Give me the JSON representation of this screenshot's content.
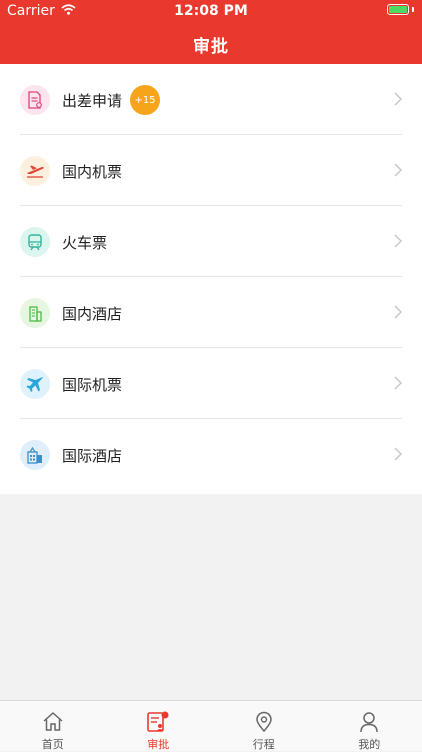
{
  "status_bar": {
    "carrier": "Carrier",
    "time": "12:08 PM"
  },
  "header": {
    "title": "审批"
  },
  "colors": {
    "accent": "#e9392f",
    "badge": "#f6a51b"
  },
  "menu": {
    "items": [
      {
        "label": "出差申请",
        "icon": "document-form-icon",
        "badge": "+15"
      },
      {
        "label": "国内机票",
        "icon": "airplane-takeoff-icon"
      },
      {
        "label": "火车票",
        "icon": "train-icon"
      },
      {
        "label": "国内酒店",
        "icon": "building-icon"
      },
      {
        "label": "国际机票",
        "icon": "airplane-icon"
      },
      {
        "label": "国际酒店",
        "icon": "hotel-icon"
      }
    ]
  },
  "tabs": [
    {
      "label": "首页",
      "icon": "home-icon"
    },
    {
      "label": "审批",
      "icon": "approval-icon",
      "active": true
    },
    {
      "label": "行程",
      "icon": "location-pin-icon"
    },
    {
      "label": "我的",
      "icon": "user-icon"
    }
  ]
}
